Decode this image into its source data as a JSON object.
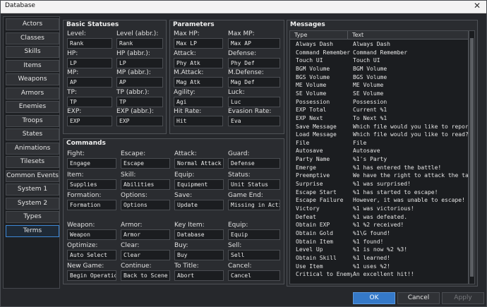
{
  "window": {
    "title": "Database",
    "close": "✕"
  },
  "sidebar": [
    "Actors",
    "Classes",
    "Skills",
    "Items",
    "Weapons",
    "Armors",
    "Enemies",
    "Troops",
    "States",
    "Animations",
    "Tilesets",
    "Common Events",
    "System 1",
    "System 2",
    "Types",
    "Terms"
  ],
  "basic": {
    "title": "Basic Statuses",
    "items": [
      {
        "l": "Level:",
        "v": "Rank",
        "l2": "Level (abbr.):",
        "v2": "Rank"
      },
      {
        "l": "HP:",
        "v": "LP",
        "l2": "HP (abbr.):",
        "v2": "LP"
      },
      {
        "l": "MP:",
        "v": "AP",
        "l2": "MP (abbr.):",
        "v2": "AP"
      },
      {
        "l": "TP:",
        "v": "TP",
        "l2": "TP (abbr.):",
        "v2": "TP"
      },
      {
        "l": "EXP:",
        "v": "EXP",
        "l2": "EXP (abbr.):",
        "v2": "EXP"
      }
    ]
  },
  "params": {
    "title": "Parameters",
    "items": [
      {
        "l": "Max HP:",
        "v": "Max LP",
        "l2": "Max MP:",
        "v2": "Max AP"
      },
      {
        "l": "Attack:",
        "v": "Phy Atk",
        "l2": "Defense:",
        "v2": "Phy Def"
      },
      {
        "l": "M.Attack:",
        "v": "Mag Atk",
        "l2": "M.Defense:",
        "v2": "Mag Def"
      },
      {
        "l": "Agility:",
        "v": "Agi",
        "l2": "Luck:",
        "v2": "Luc"
      },
      {
        "l": "Hit Rate:",
        "v": "Hit",
        "l2": "Evasion Rate:",
        "v2": "Eva"
      }
    ]
  },
  "commands": {
    "title": "Commands",
    "rows": [
      [
        [
          "Fight:",
          "Engage"
        ],
        [
          "Escape:",
          "Escape"
        ],
        [
          "Attack:",
          "Normal Attack"
        ],
        [
          "Guard:",
          "Defense"
        ]
      ],
      [
        [
          "Item:",
          "Supplies"
        ],
        [
          "Skill:",
          "Abilities"
        ],
        [
          "Equip:",
          "Equipment"
        ],
        [
          "Status:",
          "Unit Status"
        ]
      ],
      [
        [
          "Formation:",
          "Formation"
        ],
        [
          "Options:",
          "Options"
        ],
        [
          "Save:",
          "Update"
        ],
        [
          "Game End:",
          "Missing in Action"
        ]
      ],
      [
        [
          "Weapon:",
          "Weapon"
        ],
        [
          "Armor:",
          "Armor"
        ],
        [
          "Key Item:",
          "Database"
        ],
        [
          "Equip:",
          "Equip"
        ]
      ],
      [
        [
          "Optimize:",
          "Auto Select"
        ],
        [
          "Clear:",
          "Clear"
        ],
        [
          "Buy:",
          "Buy"
        ],
        [
          "Sell:",
          "Sell"
        ]
      ],
      [
        [
          "New Game:",
          "Begin Operation"
        ],
        [
          "Continue:",
          "Back to Scene"
        ],
        [
          "To Title:",
          "Abort"
        ],
        [
          "Cancel:",
          "Cancel"
        ]
      ]
    ]
  },
  "messages": {
    "title": "Messages",
    "col_type": "Type",
    "col_text": "Text",
    "rows": [
      [
        "Always Dash",
        "Always Dash"
      ],
      [
        "Command Remember",
        "Command Remember"
      ],
      [
        "Touch UI",
        "Touch UI"
      ],
      [
        "BGM Volume",
        "BGM Volume"
      ],
      [
        "BGS Volume",
        "BGS Volume"
      ],
      [
        "ME Volume",
        "ME Volume"
      ],
      [
        "SE Volume",
        "SE Volume"
      ],
      [
        "Possession",
        "Possession"
      ],
      [
        "EXP Total",
        "Current %1"
      ],
      [
        "EXP Next",
        "To Next %1"
      ],
      [
        "Save Message",
        "Which file would you like to report to?"
      ],
      [
        "Load Message",
        "Which file would you like to read?"
      ],
      [
        "File",
        "File"
      ],
      [
        "Autosave",
        "Autosave"
      ],
      [
        "Party Name",
        "%1's Party"
      ],
      [
        "Emerge",
        "%1 has entered the battle!"
      ],
      [
        "Preemptive",
        "We have the right to attack the targe..."
      ],
      [
        "Surprise",
        "%1 was surprised!"
      ],
      [
        "Escape Start",
        "%1 has started to escape!"
      ],
      [
        "Escape Failure",
        "However, it was unable to escape!"
      ],
      [
        "Victory",
        "%1 was victorious!"
      ],
      [
        "Defeat",
        "%1 was defeated."
      ],
      [
        "Obtain EXP",
        "%1 %2 received!"
      ],
      [
        "Obtain Gold",
        "%1\\G found!"
      ],
      [
        "Obtain Item",
        "%1 found!"
      ],
      [
        "Level Up",
        "%1 is now %2 %3!"
      ],
      [
        "Obtain Skill",
        "%1 learned!"
      ],
      [
        "Use Item",
        "%1 uses %2!"
      ],
      [
        "Critical to Enemy",
        "An excellent hit!!"
      ]
    ]
  },
  "buttons": {
    "ok": "OK",
    "cancel": "Cancel",
    "apply": "Apply"
  }
}
